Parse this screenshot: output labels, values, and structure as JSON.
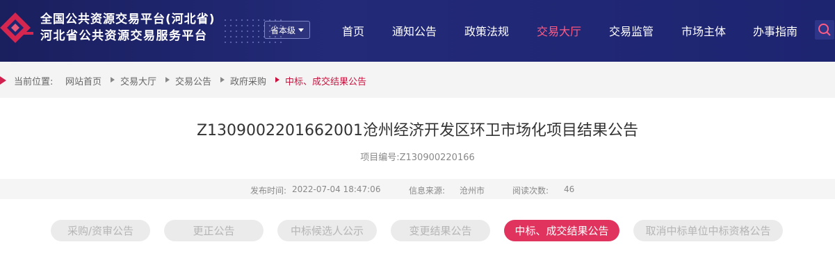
{
  "header": {
    "site_name_line1": "全国公共资源交易平台(河北省)",
    "site_name_line2": "河北省公共资源交易服务平台",
    "level_select": "省本级",
    "nav": [
      {
        "label": "首页",
        "active": false
      },
      {
        "label": "通知公告",
        "active": false
      },
      {
        "label": "政策法规",
        "active": false
      },
      {
        "label": "交易大厅",
        "active": true
      },
      {
        "label": "交易监管",
        "active": false
      },
      {
        "label": "市场主体",
        "active": false
      },
      {
        "label": "办事指南",
        "active": false
      }
    ],
    "accent_color": "#ff5b84",
    "background_color": "#1d2470"
  },
  "breadcrumb": {
    "prefix": "当前位置:",
    "items": [
      "网站首页",
      "交易大厅",
      "交易公告",
      "政府采购"
    ],
    "current": "中标、成交结果公告"
  },
  "article": {
    "title": "Z1309002201662001沧州经济开发区环卫市场化项目结果公告",
    "project_no": "项目编号:Z130900220166",
    "meta": {
      "publish_label": "发布时间:",
      "publish_time": "2022-07-04 18:47:06",
      "source_label": "信息来源:",
      "source": "沧州市",
      "views_label": "阅读次数:",
      "views": "46"
    }
  },
  "tabs": [
    {
      "label": "采购/资审公告",
      "active": false
    },
    {
      "label": "更正公告",
      "active": false
    },
    {
      "label": "中标候选人公示",
      "active": false
    },
    {
      "label": "变更结果公告",
      "active": false
    },
    {
      "label": "中标、成交结果公告",
      "active": true
    },
    {
      "label": "取消中标单位中标资格公告",
      "active": false
    }
  ],
  "tab_active_color": "#e0335e"
}
